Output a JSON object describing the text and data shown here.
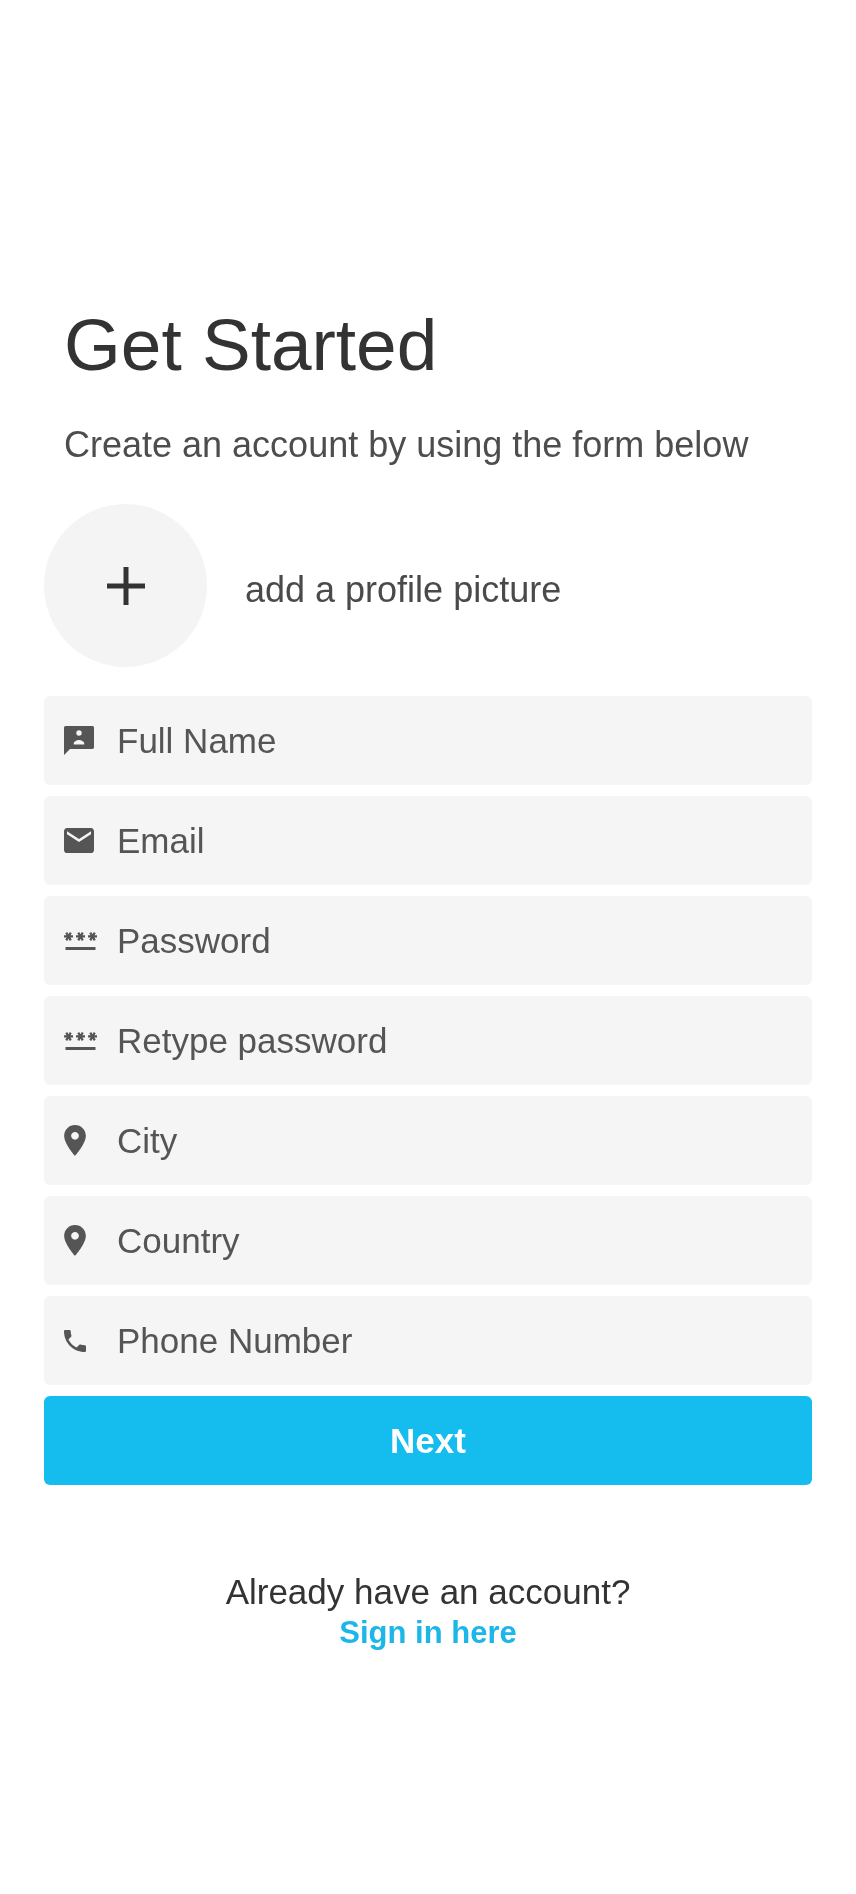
{
  "header": {
    "title": "Get Started",
    "subtitle": "Create an account by using the form below"
  },
  "profile_picture": {
    "label": "add a profile picture"
  },
  "fields": [
    {
      "kind": "name",
      "placeholder": "Full Name"
    },
    {
      "kind": "email",
      "placeholder": "Email"
    },
    {
      "kind": "password",
      "placeholder": "Password"
    },
    {
      "kind": "password",
      "placeholder": "Retype password"
    },
    {
      "kind": "location",
      "placeholder": "City"
    },
    {
      "kind": "location",
      "placeholder": "Country"
    },
    {
      "kind": "phone",
      "placeholder": "Phone Number"
    }
  ],
  "next_button": {
    "label": "Next"
  },
  "footer": {
    "prompt": "Already have an account?",
    "link": "Sign in here"
  }
}
